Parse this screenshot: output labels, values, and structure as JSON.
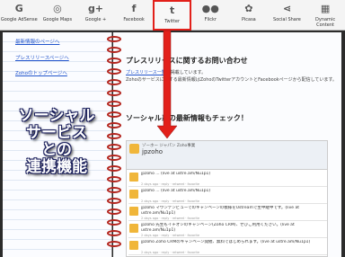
{
  "toolbar": {
    "items": [
      {
        "label": "Google AdSense",
        "icon": "G"
      },
      {
        "label": "Google Maps",
        "icon": "◎"
      },
      {
        "label": "Google +",
        "icon": "g+"
      },
      {
        "label": "Facebook",
        "icon": "f"
      },
      {
        "label": "Twitter",
        "icon": "t"
      },
      {
        "label": "Flickr",
        "icon": "●●"
      },
      {
        "label": "Picasa",
        "icon": "✿"
      },
      {
        "label": "Social Share",
        "icon": "⋖"
      },
      {
        "label": "Dynamic Content",
        "icon": "▦"
      }
    ]
  },
  "left_page": {
    "links": [
      "最新情報のページへ",
      "プレスリリースページへ",
      "Zohoのトップページへ"
    ],
    "big_text": [
      "ソーシャル",
      "サービス",
      "との",
      "連携機能"
    ]
  },
  "right_page": {
    "press_title": "プレスリリースに関するお問い合わせ",
    "press_link": "プレスリリース一覧",
    "press_link_suffix": "を掲載しています。",
    "press_desc": "Zohoのサービスに関する最新情報はZohoのTwitterアカウントとFacebookページから配信しています。",
    "social_title": "ソーシャル系の最新情報もチェック！",
    "widget": {
      "sub": "ゾーホー ジャパン Zoho事業",
      "name": "jpzoho",
      "tweets": [
        {
          "text": "jpzoho ... (live at ustre.am/Nu1p1)",
          "url": "ustre.am/Nu1p1",
          "meta": "2 days ago · reply · retweet · favorite"
        },
        {
          "text": "jpzoho ... (live at ustre.am/Nu1p1)",
          "url": "ustre.am/Nu1p1",
          "meta": "2 days ago · reply · retweet · favorite"
        },
        {
          "text": "jpzoho マウンテンビューでのキャンペーンの模様をUstreamで生中継中です。(live at ustre.am/Nu1p1)",
          "url": "ustre.am/Nu1p1",
          "meta": "2 days ago · reply · retweet · favorite"
        },
        {
          "text": "jpzoho 先生もイチオシのキャンペーン(Zoho CRM)、ぜひご利用ください。(live at ustre.am/Nu1p1)",
          "url": "ustre.am/Nu1p1",
          "meta": "2 days ago · reply · retweet · favorite"
        },
        {
          "text": "jpzoho Zoho CRMのキャンペーン開催、無料ではじめられます。(live at ustre.am/Nu1p1)",
          "url": "ustre.am/Nu1p1",
          "meta": "2 days ago · reply · retweet · favorite"
        },
        {
          "text": "jpzoho Zoho CRMのキャンペーンのお知らせです。ここをクリックするとすぐに(live at ustre.am/Nu1p1)",
          "url": "ustre.am/Nu1p1",
          "meta": "2 days ago · reply · retweet · favorite"
        }
      ]
    }
  },
  "colors": {
    "highlight": "#e2201a",
    "link": "#2255cc",
    "ring": "#b3241d"
  }
}
